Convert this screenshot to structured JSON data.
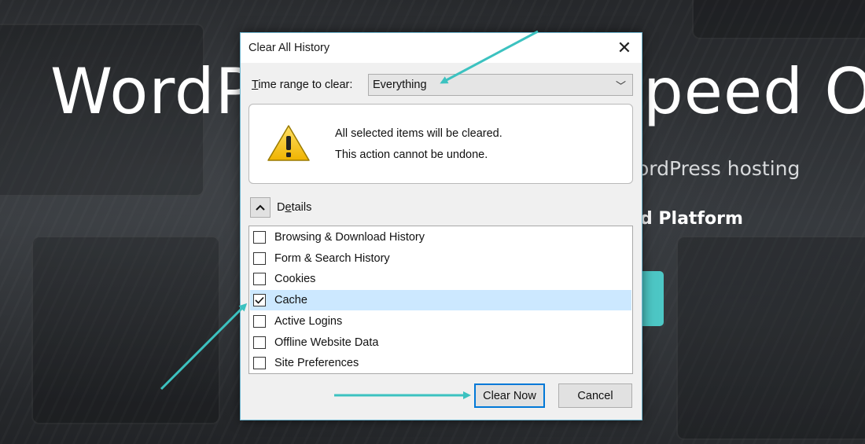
{
  "background": {
    "hero_left": "WordP",
    "hero_right": "peed Of",
    "subtitle_right": "ordPress hosting",
    "tagline_right": "d Platform",
    "accent_color": "#4dc7c5"
  },
  "dialog": {
    "title": "Clear All History",
    "close_glyph": "✕",
    "time_range": {
      "label_mnemonic": "T",
      "label_rest": "ime range to clear:",
      "value": "Everything",
      "chevron": "﹀"
    },
    "warning": {
      "icon": "warning-triangle-icon",
      "line1": "All selected items will be cleared.",
      "line2": "This action cannot be undone."
    },
    "details": {
      "label_pre": "D",
      "label_mnemonic": "e",
      "label_post": "tails",
      "toggle_icon": "chevron-up-icon"
    },
    "items": [
      {
        "label": "Browsing & Download History",
        "checked": false
      },
      {
        "label": "Form & Search History",
        "checked": false
      },
      {
        "label": "Cookies",
        "checked": false
      },
      {
        "label": "Cache",
        "checked": true
      },
      {
        "label": "Active Logins",
        "checked": false
      },
      {
        "label": "Offline Website Data",
        "checked": false
      },
      {
        "label": "Site Preferences",
        "checked": false
      }
    ],
    "buttons": {
      "clear_now": "Clear Now",
      "cancel": "Cancel"
    },
    "annotation_arrow_color": "#3cc2c0"
  }
}
